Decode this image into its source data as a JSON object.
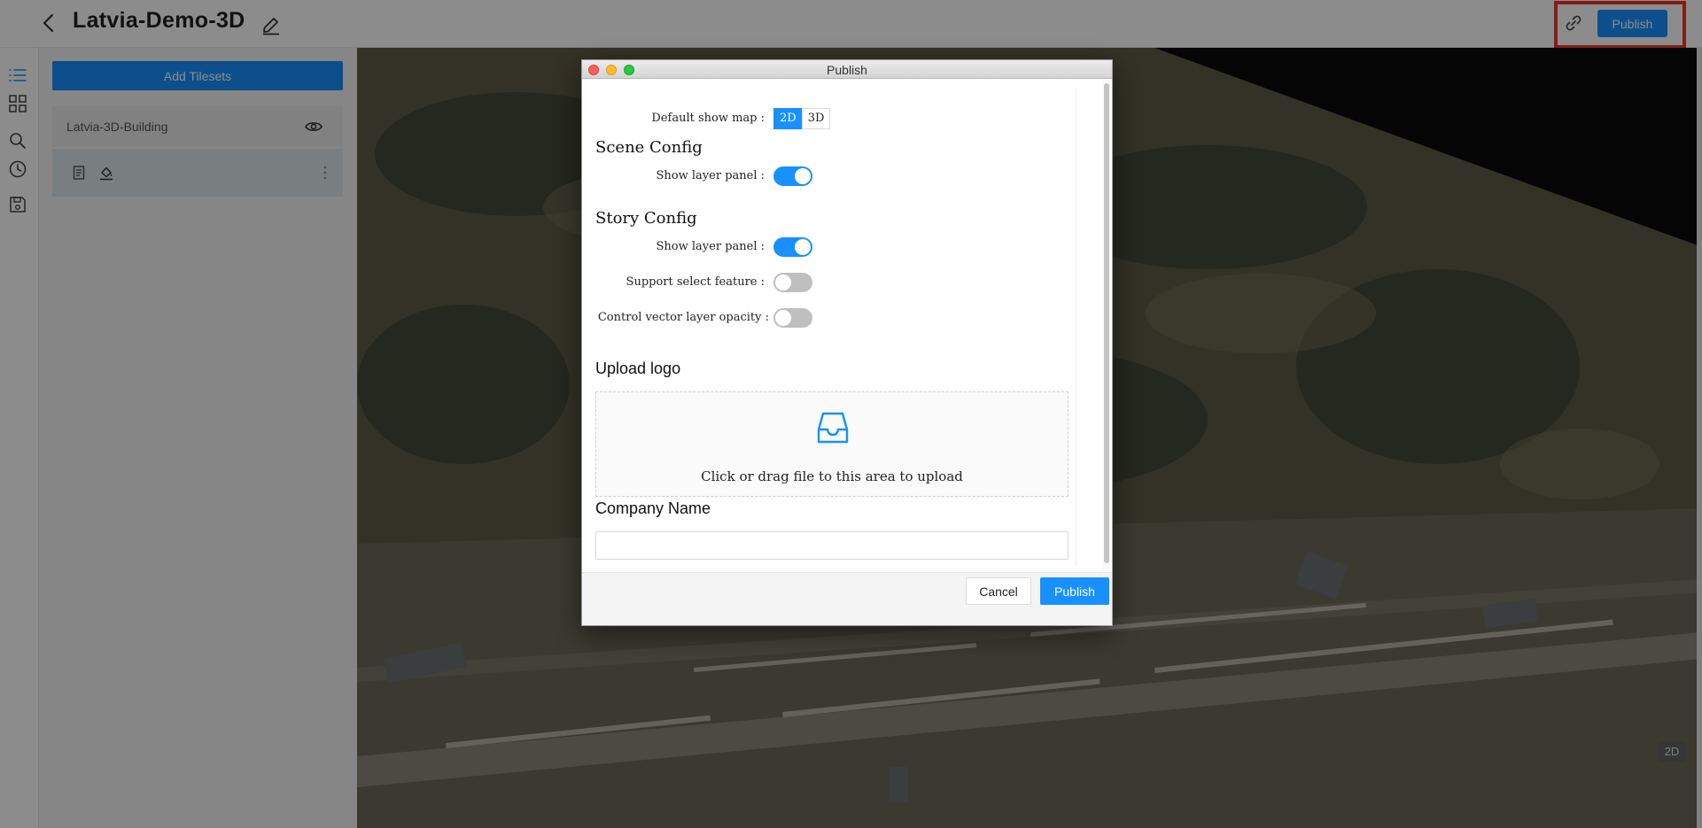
{
  "app": {
    "project_title": "Latvia-Demo-3D",
    "header": {
      "back_icon": "chevron-left-icon",
      "edit_icon": "pencil-icon",
      "link_icon": "link-icon",
      "publish_label": "Publish"
    },
    "rail": {
      "icons": [
        "list-icon",
        "grid-icon",
        "search-icon",
        "clock-icon",
        "save-icon"
      ]
    },
    "panel": {
      "add_tilesets_label": "Add Tilesets",
      "layers": [
        {
          "name": "Latvia-3D-Building",
          "visibility_icon": "eye-icon"
        }
      ],
      "tool_icons": [
        "document-icon",
        "paint-bucket-icon",
        "more-vertical-icon"
      ]
    },
    "map": {
      "mode_label": "2D"
    }
  },
  "modal": {
    "title": "Publish",
    "default_show_map": {
      "label": "Default show map :",
      "options": [
        "2D",
        "3D"
      ],
      "selected": "2D"
    },
    "scene_config": {
      "title": "Scene Config",
      "show_layer_panel": {
        "label": "Show layer panel :",
        "checked": true
      }
    },
    "story_config": {
      "title": "Story Config",
      "show_layer_panel": {
        "label": "Show layer panel :",
        "checked": true
      },
      "support_select_feature": {
        "label": "Support select feature :",
        "checked": false
      },
      "control_vector_layer_opacity": {
        "label": "Control vector layer opacity :",
        "checked": false
      }
    },
    "upload_logo": {
      "title": "Upload logo",
      "icon": "inbox-icon",
      "hint": "Click or drag file to this area to upload"
    },
    "company_name": {
      "title": "Company Name",
      "value": "",
      "placeholder": ""
    },
    "footer": {
      "cancel_label": "Cancel",
      "publish_label": "Publish"
    }
  },
  "colors": {
    "primary": "#1890ff",
    "highlight": "#e8352b"
  }
}
